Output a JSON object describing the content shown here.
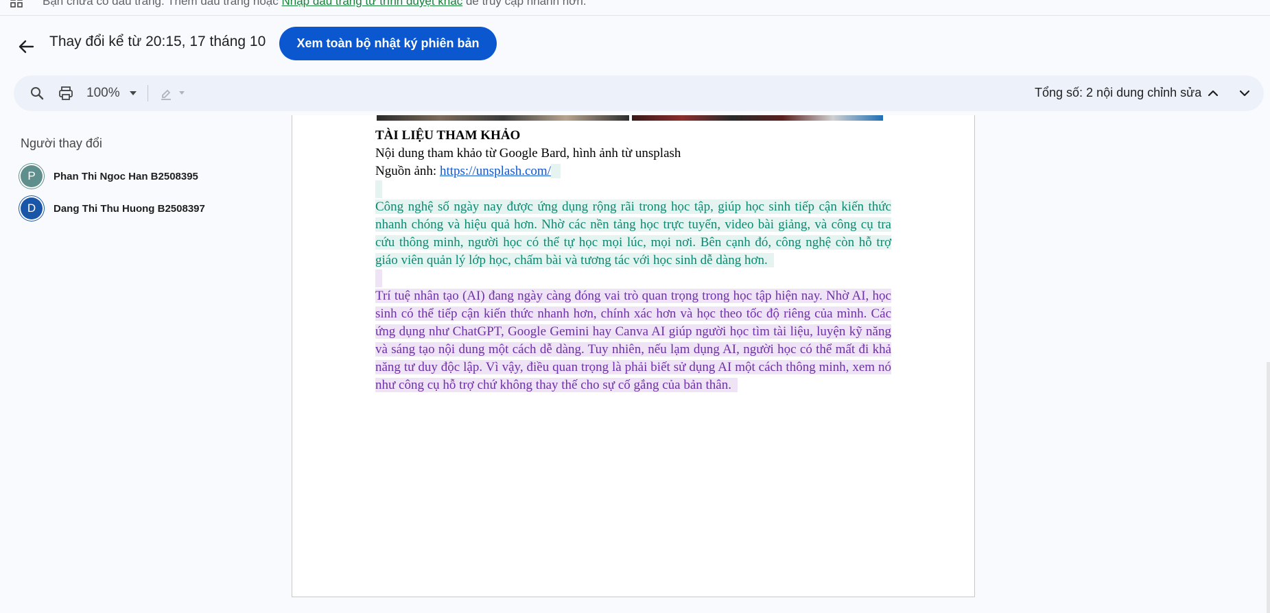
{
  "bookmark_bar": {
    "icon": "apps-grid-icon",
    "text_before": "Bạn chưa có dấu trang. Thêm dấu trang hoặc",
    "link": "Nhập dấu trang từ trình duyệt khác",
    "text_after": "để truy cập nhanh hơn."
  },
  "header": {
    "back_icon": "arrow-back-icon",
    "title": "Thay đổi kể từ 20:15, 17 tháng 10",
    "history_button": "Xem toàn bộ nhật ký phiên bản"
  },
  "toolbar": {
    "search_icon": "search-icon",
    "print_icon": "print-icon",
    "zoom": "100%",
    "pen_icon": "edit-mode-icon",
    "total_edits": "Tổng số: 2 nội dung chỉnh sửa",
    "prev_icon": "chevron-up-icon",
    "next_icon": "chevron-down-icon"
  },
  "sidebar": {
    "title": "Người thay đổi",
    "editors": [
      {
        "initial": "P",
        "name": "Phan Thi Ngoc Han B2508395",
        "color": "#5f8f8c"
      },
      {
        "initial": "D",
        "name": "Dang Thi Thu Huong B2508397",
        "color": "#1a56a8"
      }
    ]
  },
  "document": {
    "heading": "TÀI LIỆU THAM KHẢO",
    "line1": "Nội dung tham khảo từ Google Bard, hình ảnh từ unsplash",
    "source_label": "Nguồn ảnh: ",
    "source_link": "https://unsplash.com/",
    "paragraph_teal": "Công nghệ số ngày nay được ứng dụng rộng rãi trong học tập, giúp học sinh tiếp cận kiến thức nhanh chóng và hiệu quả hơn. Nhờ các nền tảng học trực tuyến, video bài giảng, và công cụ tra cứu thông minh, người học có thể tự học mọi lúc, mọi nơi. Bên cạnh đó, công nghệ còn hỗ trợ giáo viên quản lý lớp học, chấm bài và tương tác với học sinh dễ dàng hơn.",
    "paragraph_purple": "Trí tuệ nhân tạo (AI) đang ngày càng đóng vai trò quan trọng trong học tập hiện nay. Nhờ AI, học sinh có thể tiếp cận kiến thức nhanh hơn, chính xác hơn và học theo tốc độ riêng của mình. Các ứng dụng như ChatGPT, Google Gemini hay Canva AI giúp người học tìm tài liệu, luyện kỹ năng và sáng tạo nội dung một cách dễ dàng. Tuy nhiên, nếu lạm dụng AI, người học có thể mất đi khả năng tư duy độc lập. Vì vậy, điều quan trọng là phải biết sử dụng AI một cách thông minh, xem nó như công cụ hỗ trợ chứ không thay thế cho sự cố gắng của bản thân.",
    "colors": {
      "teal_text": "#0f8770",
      "teal_bg": "#e6f4f1",
      "purple_text": "#6c31a4",
      "purple_bg": "#efe4f5"
    }
  }
}
